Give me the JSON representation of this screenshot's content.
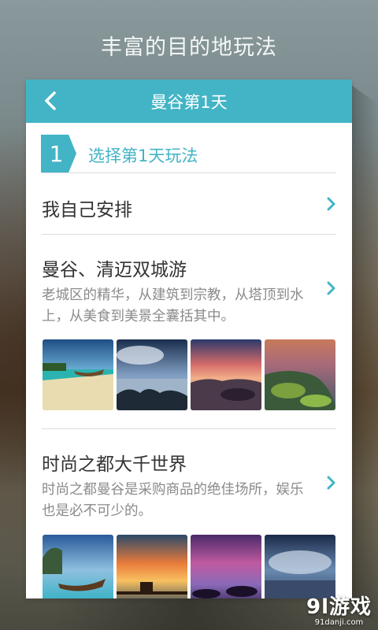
{
  "headline": "丰富的目的地玩法",
  "header": {
    "title": "曼谷第1天"
  },
  "step": {
    "number": "1",
    "label": "选择第1天玩法"
  },
  "options": [
    {
      "title": "我自己安排"
    },
    {
      "title": "曼谷、清迈双城游",
      "desc": "老城区的精华，从建筑到宗教，从塔顶到水上，从美食到美景全囊括其中。"
    },
    {
      "title": "时尚之都大千世界",
      "desc": "时尚之都曼谷是采购商品的绝佳场所，娱乐也是必不可少的。"
    }
  ],
  "colors": {
    "accent": "#43b4c6",
    "title_text": "#333333",
    "desc_text": "#8a8a8a"
  },
  "icons": {
    "back": "chevron-left-icon",
    "chevron": "chevron-right-icon"
  },
  "watermark": {
    "main": "9l游戏",
    "sub": "91danji.com"
  }
}
